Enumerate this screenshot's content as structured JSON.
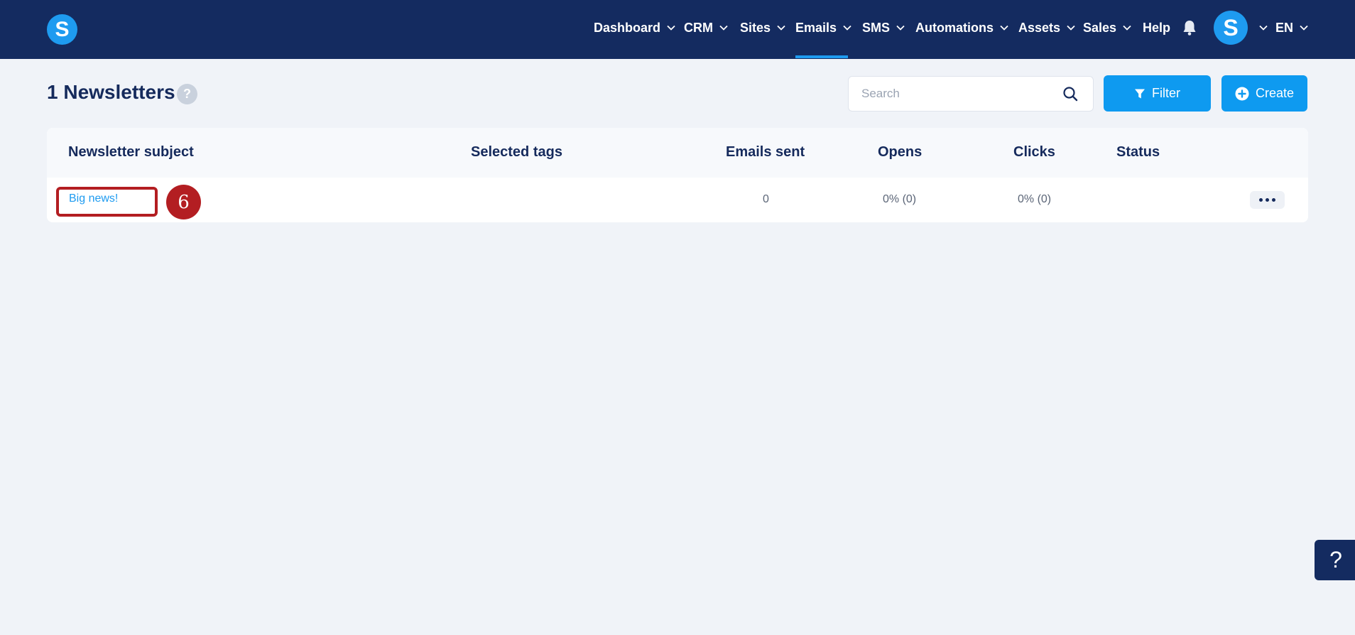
{
  "brand": {
    "logo_letter": "S"
  },
  "nav": {
    "items": [
      {
        "label": "Dashboard",
        "has_dropdown": true
      },
      {
        "label": "CRM",
        "has_dropdown": true
      },
      {
        "label": "Sites",
        "has_dropdown": true
      },
      {
        "label": "Emails",
        "has_dropdown": true,
        "active": true
      },
      {
        "label": "SMS",
        "has_dropdown": true
      },
      {
        "label": "Automations",
        "has_dropdown": true
      },
      {
        "label": "Assets",
        "has_dropdown": true
      },
      {
        "label": "Sales",
        "has_dropdown": true
      },
      {
        "label": "Help",
        "has_dropdown": false
      }
    ],
    "avatar_letter": "S",
    "language": "EN"
  },
  "page": {
    "title": "1 Newsletters",
    "help_mark": "?"
  },
  "search": {
    "placeholder": "Search",
    "value": ""
  },
  "toolbar": {
    "filter_label": "Filter",
    "create_label": "Create"
  },
  "table": {
    "headers": [
      "Newsletter subject",
      "Selected tags",
      "Emails sent",
      "Opens",
      "Clicks",
      "Status"
    ],
    "rows": [
      {
        "subject": "Big news!",
        "tags": "",
        "emails_sent": "0",
        "opens": "0% (0)",
        "clicks": "0% (0)",
        "status": ""
      }
    ]
  },
  "annotation": {
    "step_number": "6"
  },
  "help_fab": {
    "label": "?"
  },
  "colors": {
    "navbar": "#142b60",
    "accent": "#1e9bf0",
    "button": "#0e9af0",
    "page_bg": "#f0f3f8",
    "annotation": "#b31e22"
  }
}
